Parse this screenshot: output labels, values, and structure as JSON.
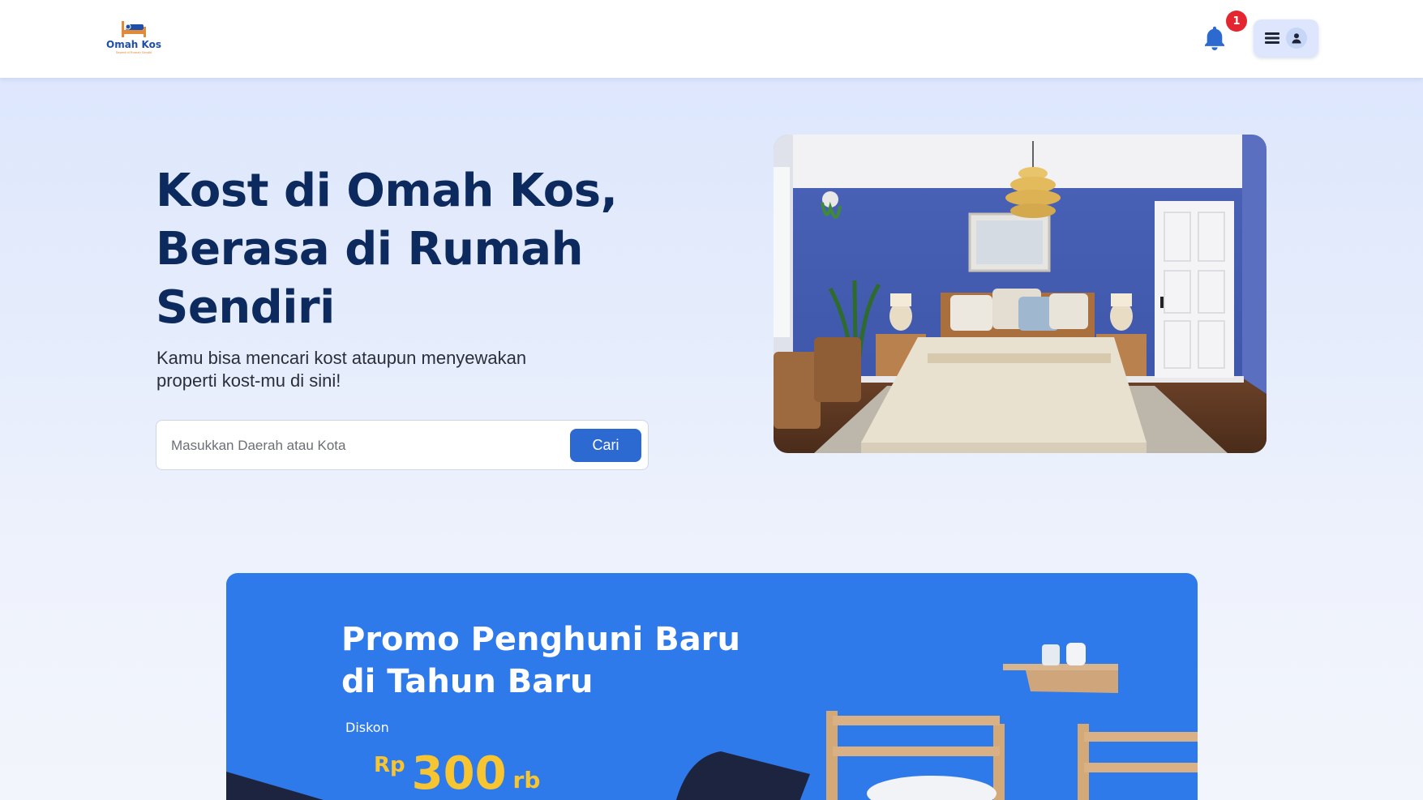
{
  "header": {
    "logo": {
      "name": "Omah Kos",
      "tagline": "Seperti di Rumah Sendiri"
    },
    "notifications": {
      "count": "1"
    }
  },
  "hero": {
    "title": "Kost di Omah Kos, Berasa di Rumah Sendiri",
    "subtitle": "Kamu bisa mencari kost ataupun menyewakan properti kost-mu di sini!",
    "search": {
      "placeholder": "Masukkan Daerah atau Kota",
      "value": "",
      "button_label": "Cari"
    }
  },
  "promo": {
    "title": "Promo Penghuni Baru di Tahun Baru",
    "discount_label": "Diskon",
    "currency": "Rp",
    "amount": "300",
    "unit": "rb"
  },
  "colors": {
    "brand_dark": "#0d2a5e",
    "primary": "#2c6ad2",
    "promo_bg": "#2f7aeb",
    "promo_accent": "#f7c531",
    "badge": "#e3262f"
  },
  "icons": {
    "notification": "bell-icon",
    "menu": "hamburger-icon",
    "user": "user-icon"
  }
}
